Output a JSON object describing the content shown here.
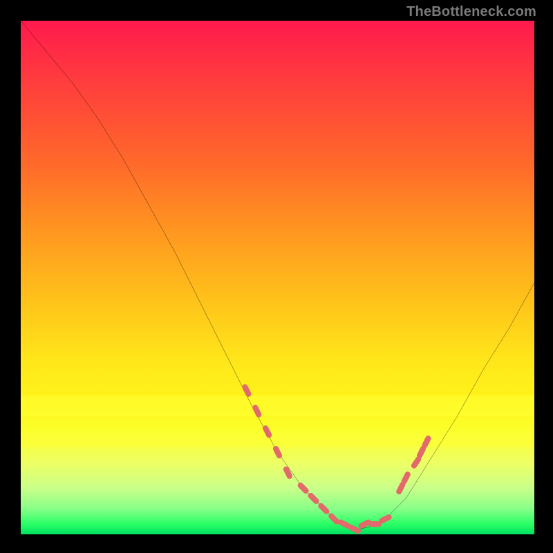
{
  "watermark": "TheBottleneck.com",
  "colors": {
    "background": "#000000",
    "gradient_top": "#ff1a4d",
    "gradient_mid": "#ffe61a",
    "gradient_bottom": "#00e060",
    "curve": "#000000",
    "marker": "#e26a6a"
  },
  "chart_data": {
    "type": "line",
    "title": "",
    "xlabel": "",
    "ylabel": "",
    "xlim": [
      0,
      100
    ],
    "ylim": [
      0,
      100
    ],
    "x": [
      0,
      5,
      10,
      15,
      20,
      25,
      30,
      35,
      40,
      45,
      50,
      55,
      60,
      63,
      66,
      70,
      75,
      80,
      85,
      90,
      95,
      100
    ],
    "values": [
      100,
      94,
      88,
      81,
      73,
      64,
      55,
      45,
      35,
      25,
      16,
      9,
      4,
      2,
      1,
      2,
      7,
      15,
      23,
      32,
      40,
      49
    ],
    "marker_points_x": [
      44,
      46,
      48,
      50,
      52,
      55,
      57,
      59,
      61,
      63,
      65,
      67,
      69,
      71,
      74,
      75,
      77,
      78,
      79
    ],
    "marker_points_y": [
      28,
      24,
      20,
      16,
      12,
      9,
      7,
      5,
      3,
      2,
      1,
      2,
      2,
      3,
      9,
      11,
      14,
      16,
      18
    ]
  }
}
